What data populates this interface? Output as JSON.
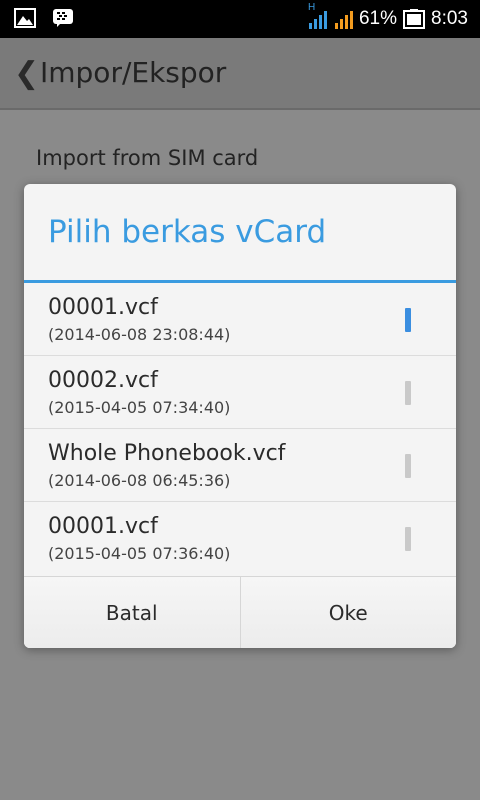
{
  "status_bar": {
    "battery_percent": "61%",
    "time": "8:03",
    "network_type": "H",
    "icons": [
      "gallery-icon",
      "bbm-icon",
      "signal-icon",
      "signal-2-icon",
      "battery-icon"
    ]
  },
  "action_bar": {
    "back_glyph": "❮",
    "title": "Impor/Ekspor"
  },
  "background": {
    "item_label": "Import from SIM card"
  },
  "dialog": {
    "title": "Pilih berkas vCard",
    "accent_color": "#3a9be0",
    "items": [
      {
        "name": "00001.vcf",
        "date": "(2014-06-08 23:08:44)",
        "selected": true
      },
      {
        "name": "00002.vcf",
        "date": "(2015-04-05 07:34:40)",
        "selected": false
      },
      {
        "name": "Whole Phonebook.vcf",
        "date": "(2014-06-08 06:45:36)",
        "selected": false
      },
      {
        "name": "00001.vcf",
        "date": "(2015-04-05 07:36:40)",
        "selected": false
      }
    ],
    "cancel_label": "Batal",
    "ok_label": "Oke"
  }
}
